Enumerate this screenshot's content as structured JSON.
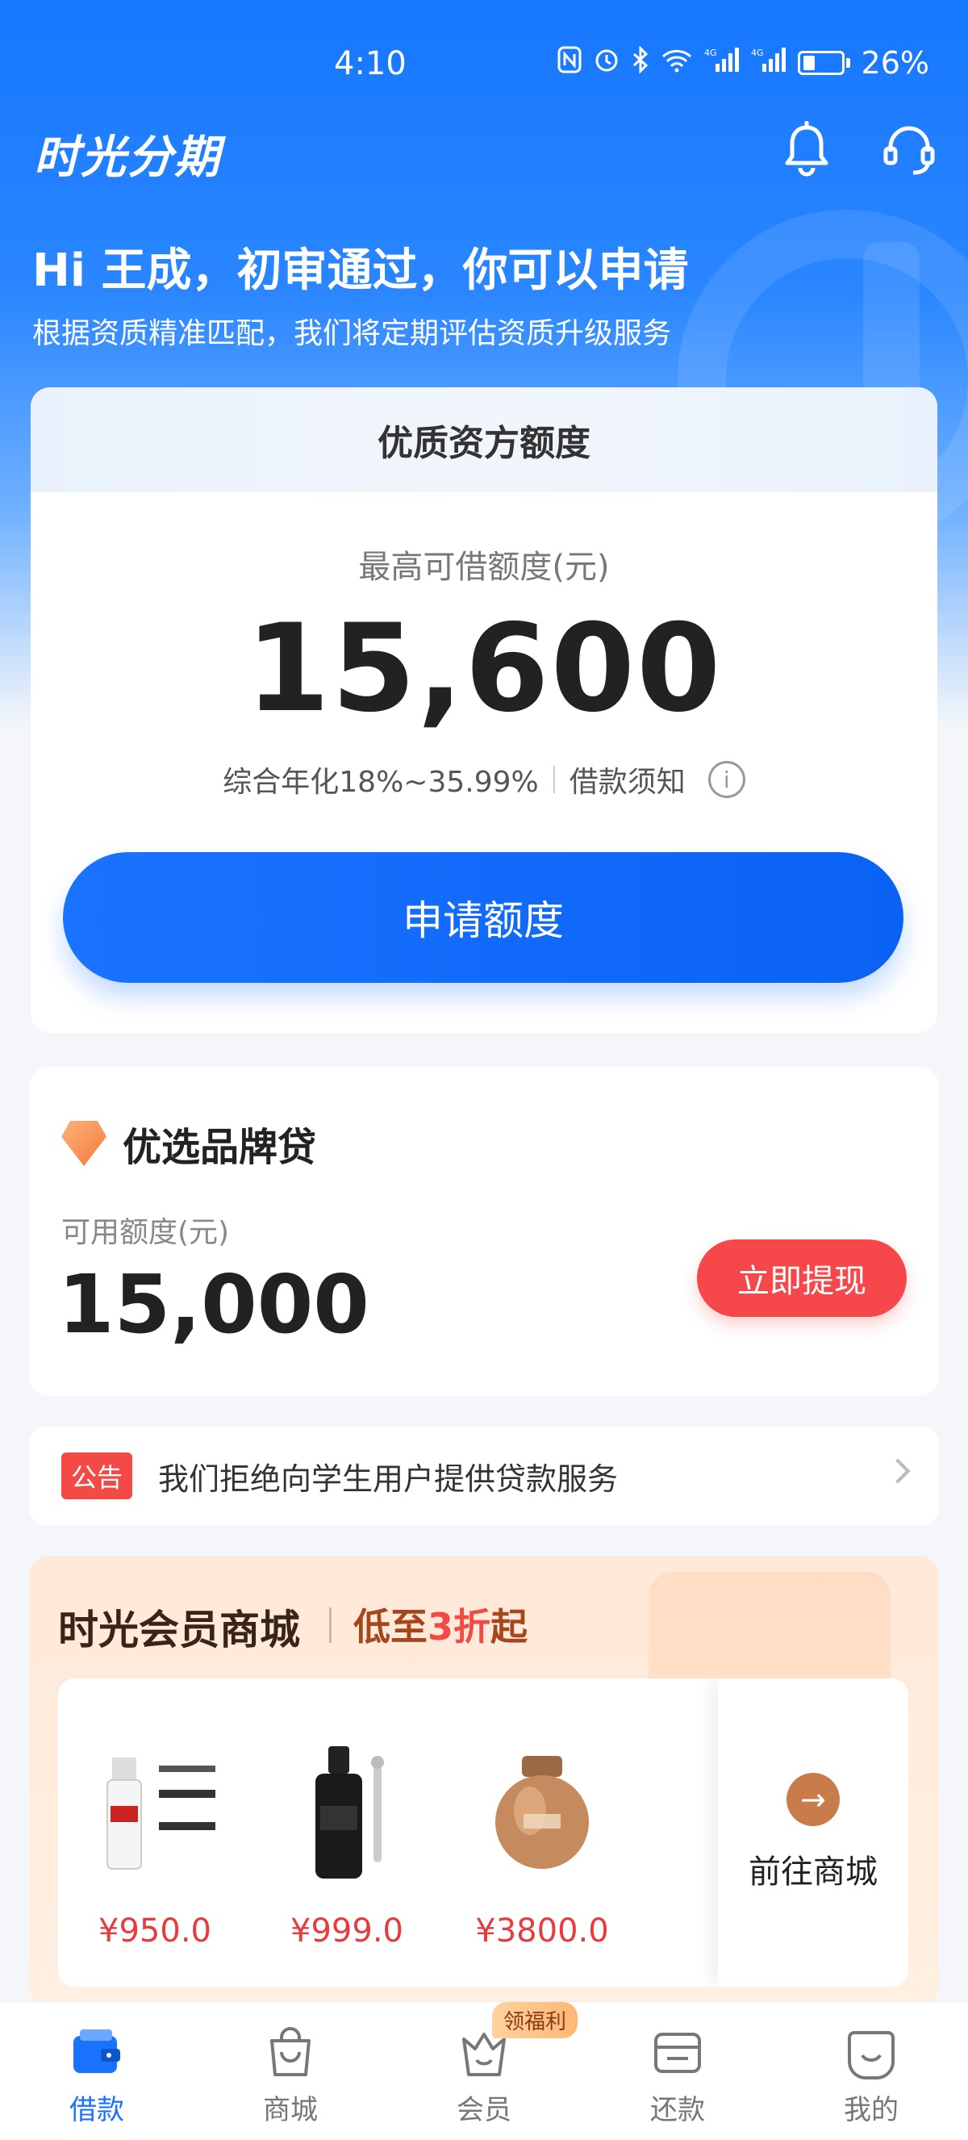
{
  "status_bar": {
    "time": "4:10",
    "battery": "26%"
  },
  "header": {
    "app_title": "时光分期"
  },
  "hero": {
    "greeting": "Hi 王成，初审通过，你可以申请",
    "subtitle": "根据资质精准匹配，我们将定期评估资质升级服务"
  },
  "quota_card": {
    "header": "优质资方额度",
    "label": "最高可借额度(元)",
    "amount": "15,600",
    "rate": "综合年化18%~35.99%",
    "notice_link": "借款须知",
    "apply_button": "申请额度"
  },
  "brand_loan": {
    "title": "优选品牌贷",
    "available_label": "可用额度(元)",
    "available_amount": "15,000",
    "withdraw_button": "立即提现"
  },
  "notice": {
    "badge": "公告",
    "text": "我们拒绝向学生用户提供贷款服务"
  },
  "mall": {
    "title": "时光会员商城",
    "promo_prefix": "低至",
    "promo_highlight": "3折",
    "promo_suffix": "起",
    "products": [
      {
        "price": "¥950.0"
      },
      {
        "price": "¥999.0"
      },
      {
        "price": "¥3800.0"
      }
    ],
    "goto_label": "前往商城"
  },
  "bottom_nav": {
    "items": [
      {
        "label": "借款"
      },
      {
        "label": "商城"
      },
      {
        "label": "会员"
      },
      {
        "label": "还款"
      },
      {
        "label": "我的"
      }
    ],
    "member_badge": "领福利"
  },
  "colors": {
    "primary": "#1a73ff",
    "danger": "#f6474a",
    "mall_accent": "#c97b4a"
  }
}
